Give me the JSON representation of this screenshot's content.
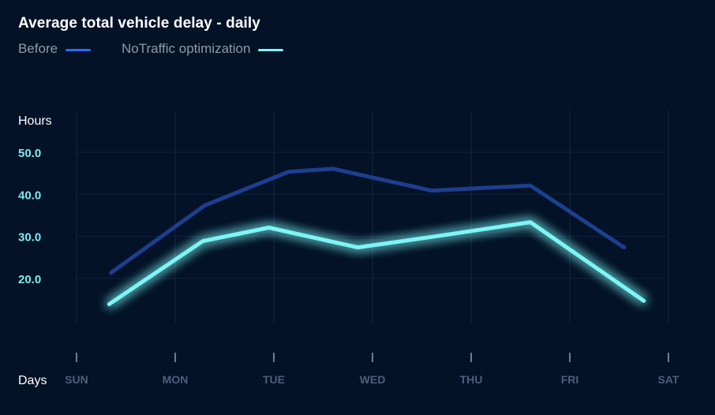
{
  "chart_data": {
    "type": "line",
    "title": "Average total vehicle delay - daily",
    "ylabel": "Hours",
    "xlabel": "Days",
    "ylim": [
      10,
      55
    ],
    "yticks": [
      "50.0",
      "40.0",
      "30.0",
      "20.0"
    ],
    "days": [
      "SUN",
      "MON",
      "TUE",
      "WED",
      "THU",
      "FRI",
      "SAT"
    ],
    "grid": true,
    "legend_position": "top-left",
    "series": [
      {
        "name": "Before",
        "color": "#1e3f8f",
        "legend_color": "#2b6bff",
        "x": [
          0.35,
          1.3,
          2.15,
          2.6,
          3.6,
          4.6,
          5.55
        ],
        "y": [
          22.5,
          38.5,
          46.5,
          47.2,
          42.0,
          43.2,
          28.5
        ]
      },
      {
        "name": "NoTraffic optimization",
        "color": "#7df5f5",
        "legend_color": "#7df5f5",
        "x": [
          0.33,
          1.28,
          1.95,
          2.85,
          3.6,
          4.6,
          5.75
        ],
        "y": [
          15.0,
          30.0,
          33.2,
          28.5,
          31.0,
          34.5,
          15.8
        ]
      }
    ]
  }
}
